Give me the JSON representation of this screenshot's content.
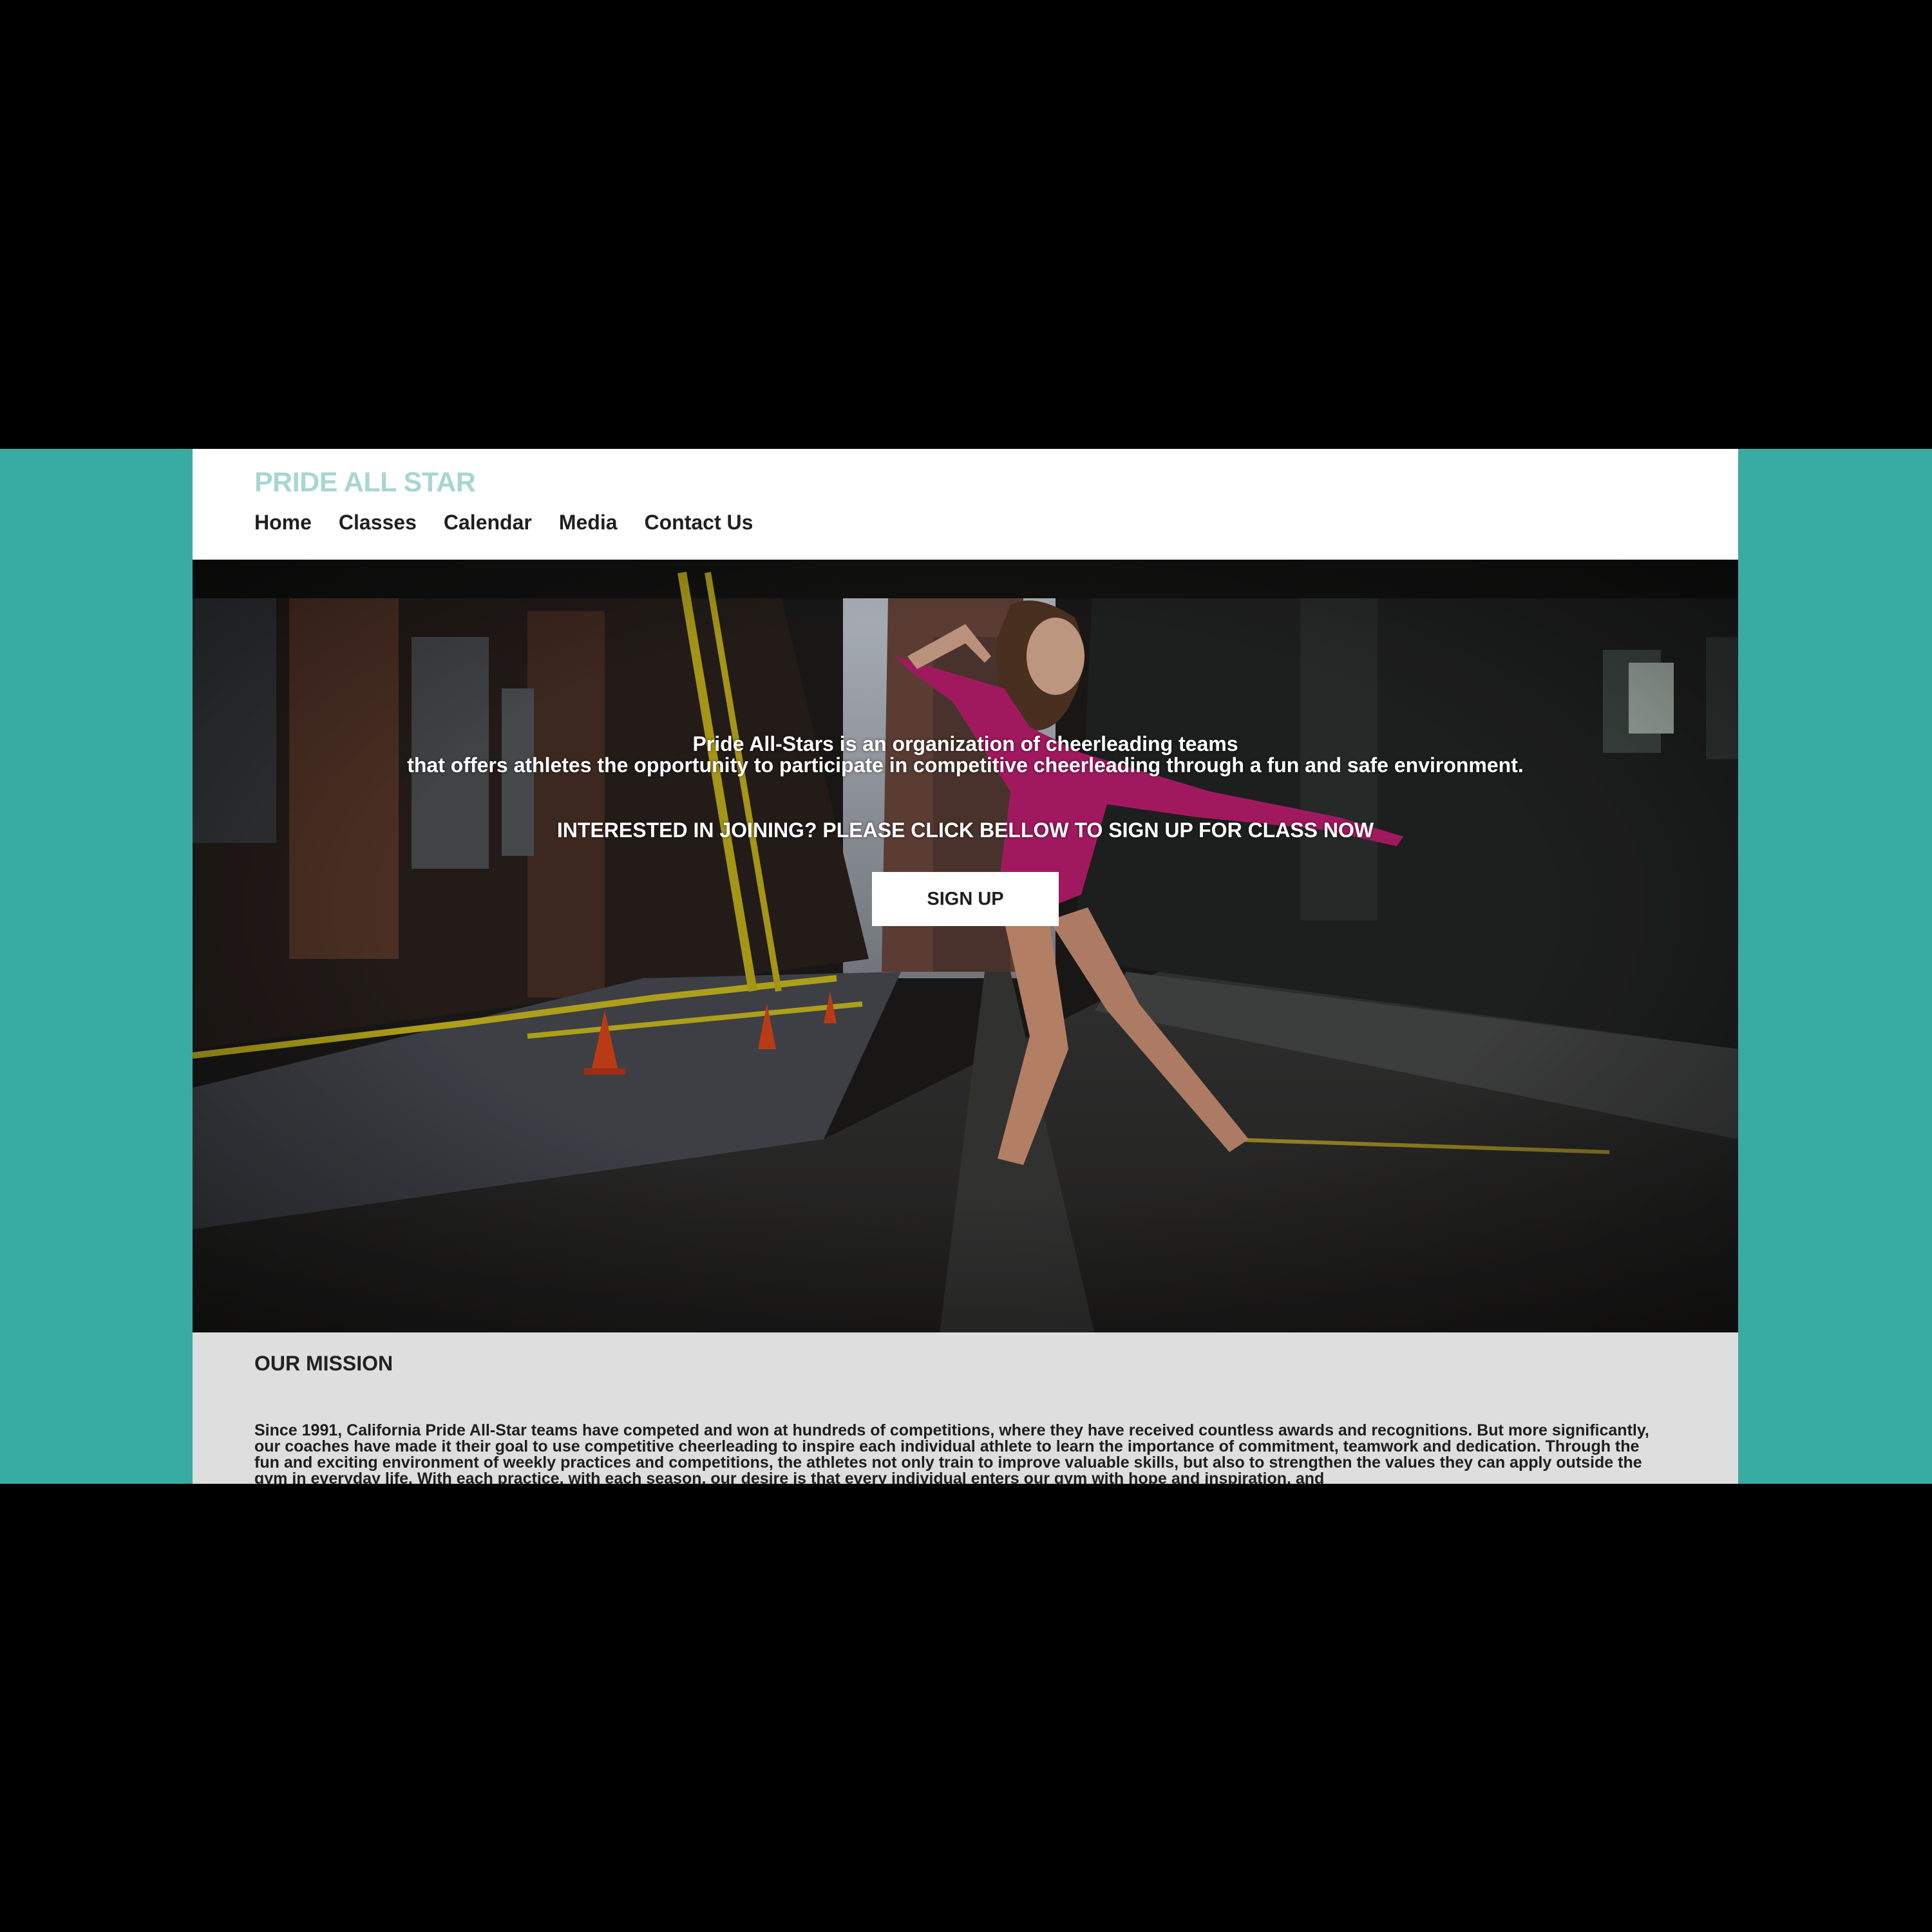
{
  "header": {
    "logo": "PRIDE ALL STAR",
    "nav": [
      {
        "label": "Home"
      },
      {
        "label": "Classes"
      },
      {
        "label": "Calendar"
      },
      {
        "label": "Media"
      },
      {
        "label": "Contact Us"
      }
    ]
  },
  "hero": {
    "tagline_line1": "Pride All-Stars is an organization of cheerleading teams",
    "tagline_line2": "that offers athletes the opportunity to participate in competitive cheerleading through a fun and safe environment.",
    "cta": "INTERESTED IN JOINING? PLEASE CLICK BELLOW TO SIGN UP FOR CLASS NOW",
    "button_label": "SIGN UP"
  },
  "mission": {
    "heading": "OUR MISSION",
    "body": "Since 1991, California Pride All-Star teams have competed and won at hundreds of competitions, where they have received countless awards and recognitions. But more significantly, our coaches have made it their goal to use competitive cheerleading to inspire each individual athlete to learn the importance of commitment, teamwork and dedication. Through the fun and exciting environment of weekly practices and competitions, the athletes not only train to improve valuable skills, but also to strengthen the values they can apply outside the gym in everyday life. With each practice, with each season, our desire is that every individual enters our gym with hope and inspiration, and"
  },
  "colors": {
    "page_background": "#38aca3",
    "logo": "#a9d6cf",
    "mission_background": "#dedede"
  }
}
